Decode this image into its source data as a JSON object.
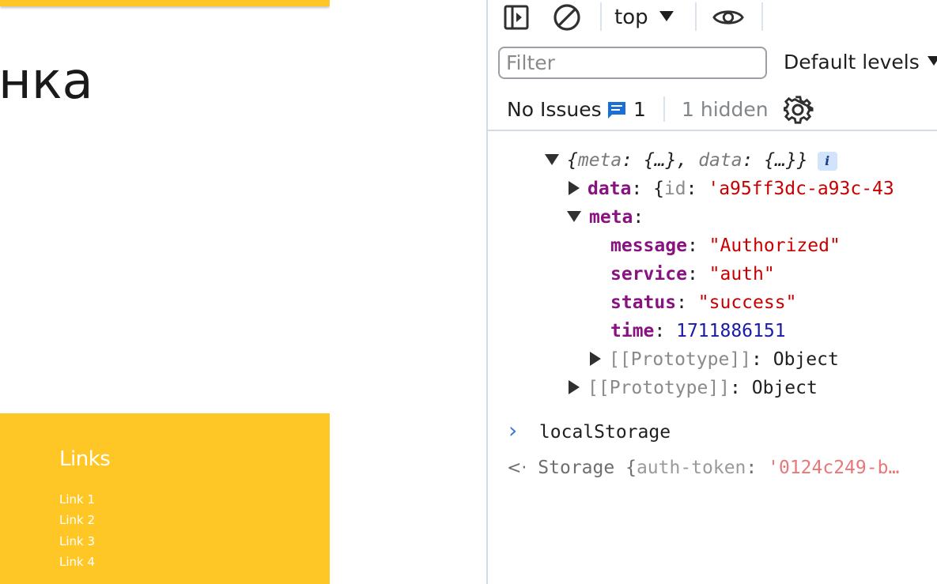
{
  "page": {
    "title_fragment": "нка",
    "footer": {
      "heading": "Links",
      "links": [
        "Link 1",
        "Link 2",
        "Link 3",
        "Link 4"
      ]
    },
    "colors": {
      "accent": "#ffc726",
      "text": "#1a1a1a"
    }
  },
  "devtools": {
    "toolbar": {
      "icons": [
        "sidebar-toggle-icon",
        "clear-console-icon",
        "eye-icon"
      ],
      "context": "top"
    },
    "filter": {
      "placeholder": "Filter",
      "value": ""
    },
    "levels": "Default levels",
    "issues": {
      "label": "No Issues",
      "count": "1",
      "hidden": "1 hidden"
    },
    "console": {
      "object_summary": {
        "open": "{",
        "k1": "meta",
        "v1": "{…}",
        "k2": "data",
        "v2": "{…}",
        "close": "}",
        "badge": "i"
      },
      "data_row": {
        "key": "data",
        "preview_key": "id",
        "preview_value": "'a95ff3dc-a93c-43"
      },
      "meta_row": {
        "key": "meta"
      },
      "meta_fields": [
        {
          "key": "message",
          "value": "\"Authorized\"",
          "type": "string"
        },
        {
          "key": "service",
          "value": "\"auth\"",
          "type": "string"
        },
        {
          "key": "status",
          "value": "\"success\"",
          "type": "string"
        },
        {
          "key": "time",
          "value": "1711886151",
          "type": "number"
        }
      ],
      "inner_prototype": {
        "key": "[[Prototype]]",
        "value": "Object"
      },
      "outer_prototype": {
        "key": "[[Prototype]]",
        "value": "Object"
      },
      "input_command": "localStorage",
      "result": {
        "type": "Storage",
        "preview_key": "auth-token",
        "preview_value": "'0124c249-b…"
      }
    }
  }
}
